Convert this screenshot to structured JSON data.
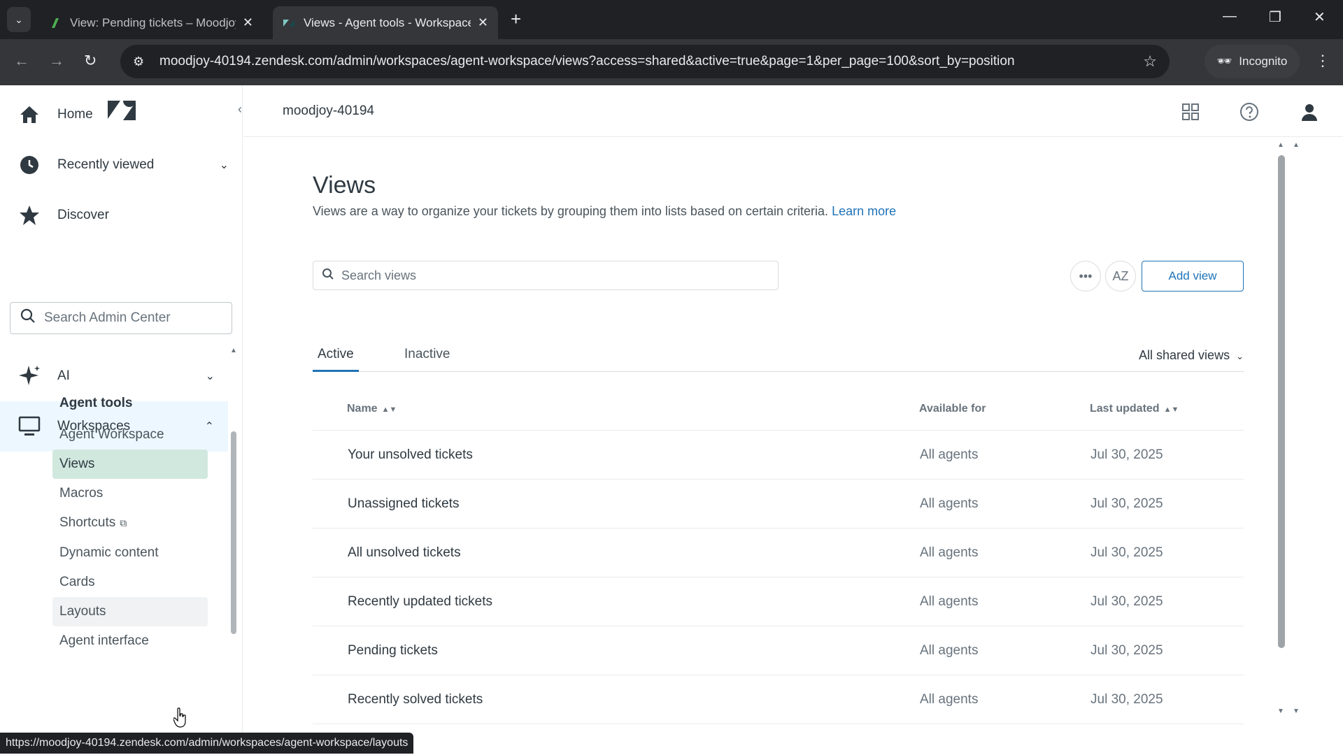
{
  "browser": {
    "tabs": [
      {
        "title": "View: Pending tickets – Moodjoy",
        "active": false
      },
      {
        "title": "Views - Agent tools - Workspaces",
        "active": true
      }
    ],
    "url": "moodjoy-40194.zendesk.com/admin/workspaces/agent-workspace/views?access=shared&active=true&page=1&per_page=100&sort_by=position",
    "incognito_label": "Incognito",
    "status_url": "https://moodjoy-40194.zendesk.com/admin/workspaces/agent-workspace/layouts"
  },
  "sidebar": {
    "nav": [
      {
        "label": "Home",
        "icon": "home-icon"
      },
      {
        "label": "Recently viewed",
        "icon": "clock-icon"
      },
      {
        "label": "Discover",
        "icon": "star-icon"
      }
    ],
    "search_placeholder": "Search Admin Center",
    "sections": [
      {
        "label": "AI",
        "icon": "sparkle-icon"
      },
      {
        "label": "Workspaces",
        "icon": "monitor-icon"
      }
    ],
    "sub_heading": "Agent tools",
    "sub_items": [
      {
        "label": "Agent Workspace"
      },
      {
        "label": "Views"
      },
      {
        "label": "Macros"
      },
      {
        "label": "Shortcuts"
      },
      {
        "label": "Dynamic content"
      },
      {
        "label": "Cards"
      },
      {
        "label": "Layouts"
      },
      {
        "label": "Agent interface"
      }
    ]
  },
  "header": {
    "account": "moodjoy-40194"
  },
  "main": {
    "title": "Views",
    "description": "Views are a way to organize your tickets by grouping them into lists based on certain criteria.",
    "learn_more": "Learn more",
    "search_placeholder": "Search views",
    "sort_button": "AZ",
    "add_view": "Add view",
    "tabs": [
      {
        "label": "Active"
      },
      {
        "label": "Inactive"
      }
    ],
    "filter": "All shared views",
    "columns": {
      "name": "Name",
      "available_for": "Available for",
      "last_updated": "Last updated"
    },
    "rows": [
      {
        "name": "Your unsolved tickets",
        "available": "All agents",
        "updated": "Jul 30, 2025"
      },
      {
        "name": "Unassigned tickets",
        "available": "All agents",
        "updated": "Jul 30, 2025"
      },
      {
        "name": "All unsolved tickets",
        "available": "All agents",
        "updated": "Jul 30, 2025"
      },
      {
        "name": "Recently updated tickets",
        "available": "All agents",
        "updated": "Jul 30, 2025"
      },
      {
        "name": "Pending tickets",
        "available": "All agents",
        "updated": "Jul 30, 2025"
      },
      {
        "name": "Recently solved tickets",
        "available": "All agents",
        "updated": "Jul 30, 2025"
      }
    ]
  },
  "colors": {
    "accent": "#1f73b7",
    "active_nav": "#d1e8df",
    "browser_dark": "#202124"
  }
}
